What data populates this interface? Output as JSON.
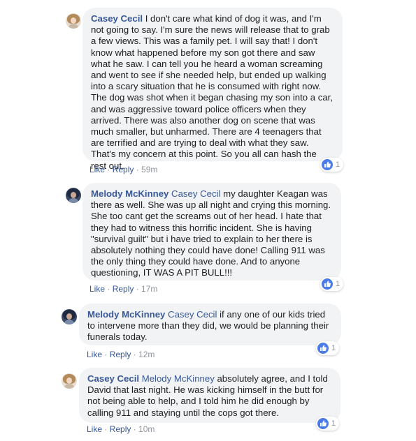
{
  "comments": [
    {
      "author": "Casey Cecil",
      "mention": "",
      "text": " I don't care what kind of dog it was, and I'm not going to say. I'm sure the news will release that to grab a few views. This was a family pet. I will say that! I don't know what happened before my son got there and saw what he saw. I can tell you he heard a woman screaming and went to see if she needed help, but ended up walking into a scary situation that he is consumed with right now. The dog was shot when it began chasing my son into a car, and was aggressive toward police officers when they arrived. There was also another dog on scene that was much smaller, but unharmed. There are 4 teenagers that are terrified and are trying to deal with what they saw. That's my concern at this point. So you all can hash the rest out.",
      "like_label": "Like",
      "reply_label": "Reply",
      "time": "59m",
      "reaction_count": "1",
      "avatar": "casey-avatar"
    },
    {
      "author": "Melody McKinney",
      "mention": " Casey Cecil",
      "text": " my daughter Keagan was there as well. She was up all night and crying this morning. She too cant get the screams out of her head. I hate that they had to witness this horrific incident. She is having \"survival guilt\" but i have tried to explain to her there is absolutely nothing they could have done! Calling 911 was the only thing they could have done. And to anyone questioning, IT WAS A PIT BULL!!!",
      "like_label": "Like",
      "reply_label": "Reply",
      "time": "17m",
      "reaction_count": "1",
      "avatar": "melody-avatar"
    },
    {
      "author": "Melody McKinney",
      "mention": " Casey Cecil",
      "text": " if any one of our kids tried to intervene more than they did, we would be planning their funerals today.",
      "like_label": "Like",
      "reply_label": "Reply",
      "time": "12m",
      "reaction_count": "1",
      "avatar": "melody-avatar"
    },
    {
      "author": "Casey Cecil",
      "mention": " Melody McKinney",
      "text": " absolutely agree, and I told David that last night. He was kicking himself in the butt for not being able to help, and I told him he did enough by calling 911 and staying until the cops got there.",
      "like_label": "Like",
      "reply_label": "Reply",
      "time": "10m",
      "reaction_count": "1",
      "avatar": "casey-avatar"
    }
  ],
  "separator": " · ",
  "reaction_icon": "thumbs-up-icon",
  "colors": {
    "link": "#385898",
    "bubble": "#f2f3f5",
    "like_badge": "#4b7be8",
    "meta": "#90949c"
  }
}
